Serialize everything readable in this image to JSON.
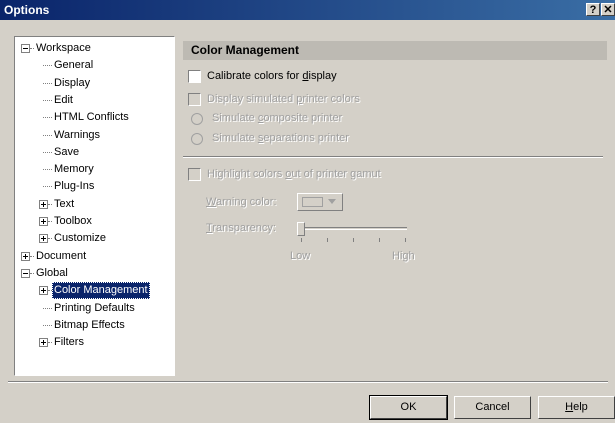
{
  "window": {
    "title": "Options",
    "help_btn": "?",
    "close_btn": "✕"
  },
  "tree": [
    {
      "label": "Workspace",
      "level": 0,
      "expander": "minus"
    },
    {
      "label": "General",
      "level": 1,
      "expander": null
    },
    {
      "label": "Display",
      "level": 1,
      "expander": null
    },
    {
      "label": "Edit",
      "level": 1,
      "expander": null
    },
    {
      "label": "HTML Conflicts",
      "level": 1,
      "expander": null
    },
    {
      "label": "Warnings",
      "level": 1,
      "expander": null
    },
    {
      "label": "Save",
      "level": 1,
      "expander": null
    },
    {
      "label": "Memory",
      "level": 1,
      "expander": null
    },
    {
      "label": "Plug-Ins",
      "level": 1,
      "expander": null
    },
    {
      "label": "Text",
      "level": 1,
      "expander": "plus"
    },
    {
      "label": "Toolbox",
      "level": 1,
      "expander": "plus"
    },
    {
      "label": "Customize",
      "level": 1,
      "expander": "plus"
    },
    {
      "label": "Document",
      "level": 0,
      "expander": "plus"
    },
    {
      "label": "Global",
      "level": 0,
      "expander": "minus"
    },
    {
      "label": "Color Management",
      "level": 1,
      "expander": "plus",
      "selected": true
    },
    {
      "label": "Printing Defaults",
      "level": 1,
      "expander": null
    },
    {
      "label": "Bitmap Effects",
      "level": 1,
      "expander": null
    },
    {
      "label": "Filters",
      "level": 1,
      "expander": "plus"
    }
  ],
  "panel": {
    "header": "Color Management",
    "calibrate": {
      "pre": "Calibrate colors for ",
      "key": "d",
      "post": "isplay",
      "checked": false
    },
    "display_sim": {
      "pre": "Display simulated ",
      "key": "p",
      "post": "rinter colors",
      "checked": false
    },
    "sim_composite": {
      "pre": "Simulate ",
      "key": "c",
      "post": "omposite printer"
    },
    "sim_separations": {
      "pre": "Simulate ",
      "key": "s",
      "post": "eparations printer"
    },
    "highlight": {
      "pre": "Highlight colors ",
      "key": "o",
      "post": "ut of printer gamut",
      "checked": false
    },
    "warning_color": {
      "key": "W",
      "post": "arning color:"
    },
    "transparency": {
      "key": "T",
      "post": "ransparency:"
    },
    "slider": {
      "min_label": "Low",
      "max_label": "High",
      "value": 0
    }
  },
  "buttons": {
    "ok": "OK",
    "cancel": "Cancel",
    "help_key": "H",
    "help_post": "elp"
  },
  "colors": {
    "title_start": "#0a246a",
    "title_end": "#3a6ea5",
    "selection": "#0a246a",
    "face": "#d4d0c8"
  }
}
